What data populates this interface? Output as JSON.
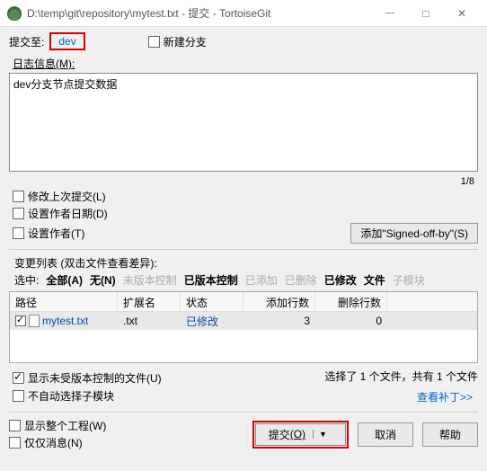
{
  "titlebar": {
    "title": "D:\\temp\\git\\repository\\mytest.txt - 提交 - TortoiseGit"
  },
  "commit_to": {
    "label": "提交至:",
    "branch": "dev",
    "new_branch_label": "新建分支"
  },
  "log": {
    "section_label": "日志信息(M):",
    "message": "dev分支节点提交数据",
    "counter": "1/8"
  },
  "options": {
    "amend": "修改上次提交(L)",
    "set_author_date": "设置作者日期(D)",
    "set_author": "设置作者(T)",
    "signed_off_btn": "添加\"Signed-off-by\"(S)"
  },
  "changes": {
    "section_label": "变更列表 (双击文件查看差异):",
    "filter_label": "选中:",
    "filters": {
      "all": "全部(A)",
      "none": "无(N)",
      "unversioned": "未版本控制",
      "versioned": "已版本控制",
      "added": "已添加",
      "deleted": "已删除",
      "modified": "已修改",
      "files": "文件",
      "submodules": "子模块"
    },
    "cols": {
      "path": "路径",
      "ext": "扩展名",
      "status": "状态",
      "add": "添加行数",
      "del": "删除行数"
    },
    "rows": [
      {
        "path": "mytest.txt",
        "ext": ".txt",
        "status": "已修改",
        "add": "3",
        "del": "0"
      }
    ],
    "status_text": "选择了 1 个文件，共有 1 个文件",
    "show_unversioned": "显示未受版本控制的文件(U)",
    "no_auto_submodule": "不自动选择子模块",
    "patch_link": "查看补丁>>"
  },
  "bottom": {
    "show_whole": "显示整个工程(W)",
    "msg_only": "仅仅消息(N)",
    "commit_btn": "提交",
    "commit_key": "(O)",
    "cancel": "取消",
    "help": "帮助"
  }
}
